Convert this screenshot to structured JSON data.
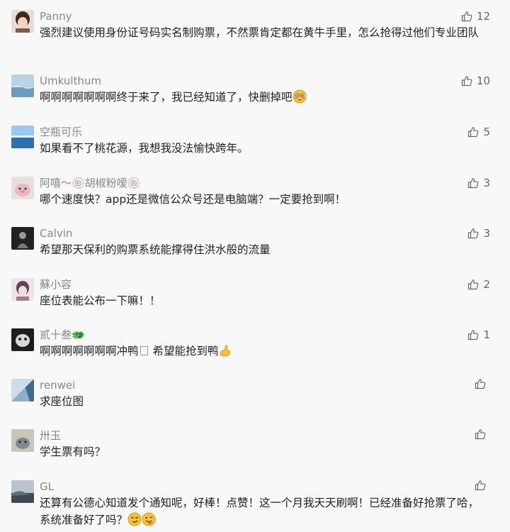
{
  "comments": [
    {
      "name": "Panny",
      "text": "强烈建议使用身份证号码实名制购票，不然票肯定都在黄牛手里，怎么抢得过他们专业团队",
      "likes": "12",
      "avatar_color": "#6b4a3a"
    },
    {
      "name": "Umkulthum",
      "text": "啊啊啊啊啊啊啊终于来了，我已经知道了，快删掉吧",
      "likes": "10",
      "avatar_color": "#8fb8d6",
      "emoji": "flushed-face"
    },
    {
      "name": "空瓶可乐",
      "text": "如果看不了桃花源，我想我没法愉快跨年。",
      "likes": "5",
      "avatar_color": "#4a7fb8"
    },
    {
      "name": "阿嘻～🍥胡椒粉嗳🍥",
      "text": "哪个速度快？app还是微信公众号还是电脑端？一定要抢到啊！",
      "likes": "3",
      "avatar_color": "#c9a2a8"
    },
    {
      "name": "Calvin",
      "text": "希望那天保利的购票系统能撑得住洪水般的流量",
      "likes": "3",
      "avatar_color": "#333333"
    },
    {
      "name": "蘇小容",
      "text": "座位表能公布一下嘛！！",
      "likes": "2",
      "avatar_color": "#b59aa6"
    },
    {
      "name": "贰十叁🐲",
      "text_a": "啊啊啊啊啊啊啊冲鸭",
      "text_b": " 希望能抢到鸭",
      "likes": "1",
      "avatar_color": "#444444",
      "emoji": "flexed-biceps"
    },
    {
      "name": "renwei",
      "text": "求座位图",
      "likes": "",
      "avatar_color": "#6f8fb0"
    },
    {
      "name": "卅玉",
      "text": "学生票有吗？",
      "likes": "",
      "avatar_color": "#8a8a80"
    },
    {
      "name": "GL",
      "text": "还算有公德心知道发个通知呢，好棒！点赞！这一个月我天天刷啊！已经准备好抢票了哈，系统准备好了吗？",
      "likes": "",
      "avatar_color": "#55606a",
      "emoji": [
        "smirking-face",
        "winking-tongue-face"
      ]
    }
  ],
  "colors": {
    "name": "#888888",
    "text": "#222222",
    "like": "#666666",
    "background": "#f8f8f8"
  }
}
